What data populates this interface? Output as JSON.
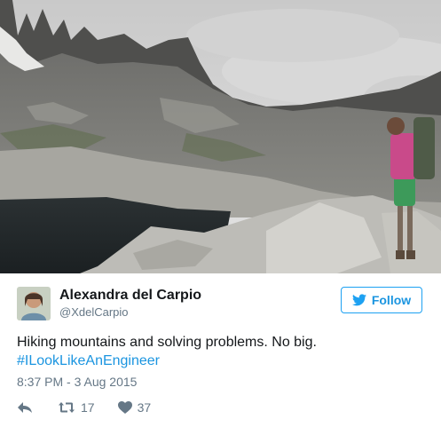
{
  "tweet": {
    "author": {
      "display_name": "Alexandra del Carpio",
      "handle": "@XdelCarpio",
      "avatar_icon": "avatar-photo"
    },
    "follow_label": "Follow",
    "text_line1": "Hiking mountains and solving problems. No big.",
    "hashtag": "#ILookLikeAnEngineer",
    "timestamp": "8:37 PM - 3 Aug 2015",
    "retweet_count": "17",
    "like_count": "37"
  },
  "colors": {
    "link_blue": "#1b95e0",
    "border_blue": "#1da1f2",
    "muted_gray": "#657786",
    "text_dark": "#14171a"
  },
  "icons": {
    "follow": "bird-icon",
    "reply": "reply-icon",
    "retweet": "retweet-icon",
    "like": "heart-icon"
  }
}
